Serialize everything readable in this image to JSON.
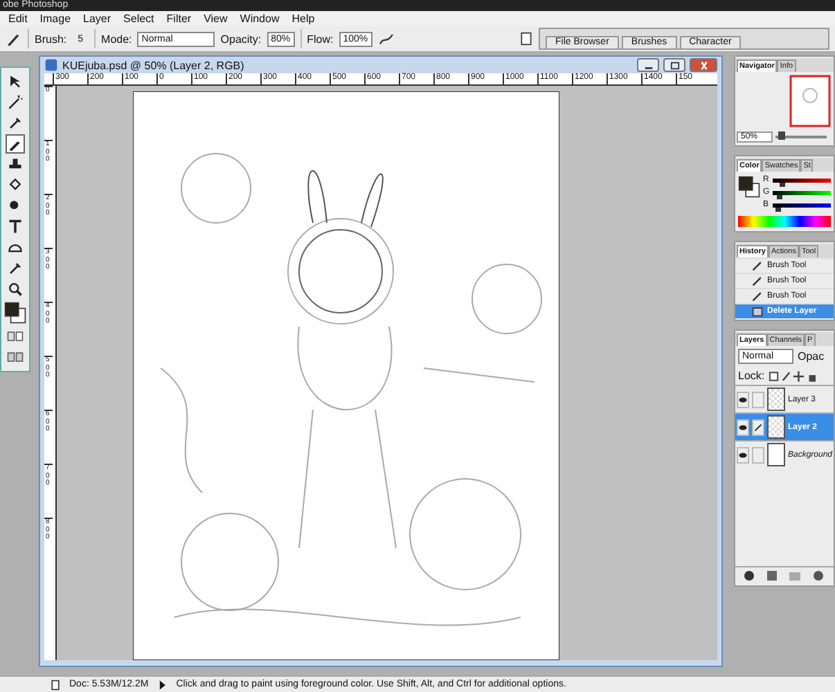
{
  "window": {
    "title": "obe Photoshop"
  },
  "menu": [
    "Edit",
    "Image",
    "Layer",
    "Select",
    "Filter",
    "View",
    "Window",
    "Help"
  ],
  "options_bar": {
    "brush_label": "Brush:",
    "brush_size": "5",
    "mode_label": "Mode:",
    "mode": "Normal",
    "opacity_label": "Opacity:",
    "opacity": "80%",
    "flow_label": "Flow:",
    "flow": "100%"
  },
  "palette_well": [
    {
      "label": "File Browser"
    },
    {
      "label": "Brushes"
    },
    {
      "label": "Character"
    }
  ],
  "tools": [
    {
      "kind": "move",
      "selected": false
    },
    {
      "kind": "wand",
      "selected": false
    },
    {
      "kind": "eyedropper",
      "selected": false
    },
    {
      "kind": "brush",
      "selected": true
    },
    {
      "kind": "stamp",
      "selected": false
    },
    {
      "kind": "bucket",
      "selected": false
    },
    {
      "kind": "dodge",
      "selected": false
    },
    {
      "kind": "type",
      "selected": false
    },
    {
      "kind": "shape",
      "selected": false
    },
    {
      "kind": "eyedropper",
      "selected": false
    },
    {
      "kind": "zoom",
      "selected": false
    }
  ],
  "document": {
    "title": "KUEjuba.psd @ 50% (Layer 2, RGB)",
    "top_ruler": [
      "300",
      "200",
      "100",
      "0",
      "100",
      "200",
      "300",
      "400",
      "500",
      "600",
      "700",
      "800",
      "900",
      "1000",
      "1100",
      "1200",
      "1300",
      "1400",
      "150"
    ],
    "left_ruler": [
      "0",
      "100",
      "200",
      "300",
      "400",
      "500",
      "600",
      "700",
      "800"
    ]
  },
  "navigator": {
    "tabs": [
      {
        "label": "Navigator",
        "selected": true
      },
      {
        "label": "Info",
        "selected": false
      }
    ],
    "zoom": "50%",
    "level": 0.1
  },
  "color": {
    "tabs": [
      {
        "label": "Color",
        "selected": true
      },
      {
        "label": "Swatches",
        "selected": false
      },
      {
        "label": "St",
        "selected": false
      }
    ],
    "channels": [
      {
        "name": "R",
        "level": 0.17
      },
      {
        "name": "G",
        "level": 0.13
      },
      {
        "name": "B",
        "level": 0.09
      }
    ]
  },
  "history": {
    "tabs": [
      {
        "label": "History",
        "selected": true
      },
      {
        "label": "Actions",
        "selected": false
      },
      {
        "label": "Tool",
        "selected": false
      }
    ],
    "items": [
      {
        "label": "Brush Tool",
        "kind": "brush",
        "selected": false
      },
      {
        "label": "Brush Tool",
        "kind": "brush",
        "selected": false
      },
      {
        "label": "Brush Tool",
        "kind": "brush",
        "selected": false
      },
      {
        "label": "Delete Layer",
        "kind": "delete",
        "selected": true
      }
    ]
  },
  "layers": {
    "tabs": [
      {
        "label": "Layers",
        "selected": true
      },
      {
        "label": "Channels",
        "selected": false
      },
      {
        "label": "P",
        "selected": false
      }
    ],
    "blend": "Normal",
    "opacity_label": "Opac",
    "lock_label": "Lock:",
    "items": [
      {
        "name": "Layer 3",
        "visible": true,
        "transparent": true,
        "selected": false,
        "italic": false
      },
      {
        "name": "Layer 2",
        "visible": true,
        "transparent": true,
        "selected": true,
        "italic": false
      },
      {
        "name": "Background",
        "visible": true,
        "transparent": false,
        "selected": false,
        "italic": true
      }
    ]
  },
  "status_bar": {
    "doc": "Doc: 5.53M/12.2M",
    "message": "Click and drag to paint using foreground color.  Use Shift, Alt, and Ctrl for additional options."
  }
}
